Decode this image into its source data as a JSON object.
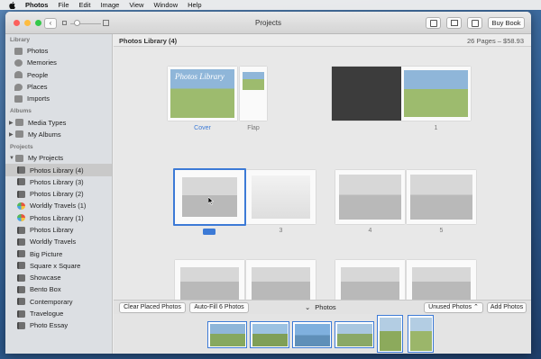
{
  "menubar": {
    "app": "Photos",
    "items": [
      "File",
      "Edit",
      "Image",
      "View",
      "Window",
      "Help"
    ]
  },
  "window": {
    "title": "Projects",
    "buy_book": "Buy Book"
  },
  "sidebar": {
    "library_header": "Library",
    "library": [
      {
        "label": "Photos",
        "icon": "photos-icon"
      },
      {
        "label": "Memories",
        "icon": "memories-icon"
      },
      {
        "label": "People",
        "icon": "people-icon"
      },
      {
        "label": "Places",
        "icon": "places-icon"
      },
      {
        "label": "Imports",
        "icon": "imports-icon"
      }
    ],
    "albums_header": "Albums",
    "albums": [
      {
        "label": "Media Types"
      },
      {
        "label": "My Albums"
      }
    ],
    "projects_header": "Projects",
    "projects_root": "My Projects",
    "projects": [
      {
        "label": "Photos Library (4)",
        "icon": "book",
        "selected": true
      },
      {
        "label": "Photos Library (3)",
        "icon": "book"
      },
      {
        "label": "Photos Library (2)",
        "icon": "book"
      },
      {
        "label": "Worldly Travels (1)",
        "icon": "globe"
      },
      {
        "label": "Photos Library (1)",
        "icon": "globe"
      },
      {
        "label": "Photos Library",
        "icon": "book"
      },
      {
        "label": "Worldly Travels",
        "icon": "book"
      },
      {
        "label": "Big Picture",
        "icon": "book"
      },
      {
        "label": "Square x Square",
        "icon": "book"
      },
      {
        "label": "Showcase",
        "icon": "book"
      },
      {
        "label": "Bento Box",
        "icon": "book"
      },
      {
        "label": "Contemporary",
        "icon": "book"
      },
      {
        "label": "Travelogue",
        "icon": "book"
      },
      {
        "label": "Photo Essay",
        "icon": "book"
      }
    ]
  },
  "main": {
    "title": "Photos Library (4)",
    "page_info": "26 Pages – $58.93",
    "cover_title": "Photos Library",
    "labels": {
      "cover": "Cover",
      "flap": "Flap",
      "p1": "1",
      "p3": "3",
      "p4": "4",
      "p5": "5"
    }
  },
  "bottombar": {
    "clear": "Clear Placed Photos",
    "autofill": "Auto-Fill 6 Photos",
    "photos": "Photos",
    "unused": "Unused Photos",
    "add": "Add Photos"
  },
  "colors": {
    "accent": "#3c7ad6",
    "selection": "#c9c9c9"
  }
}
